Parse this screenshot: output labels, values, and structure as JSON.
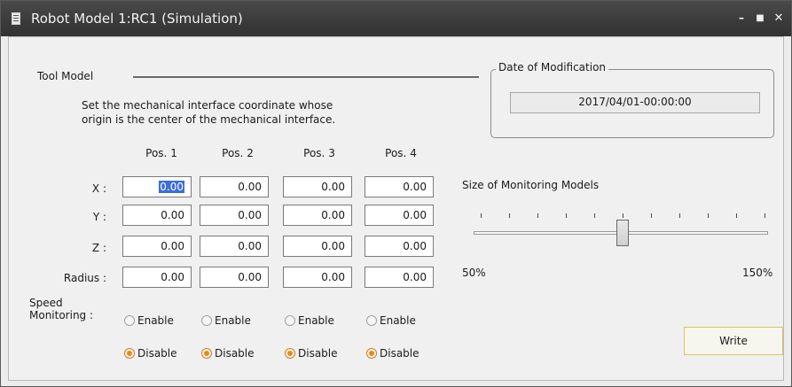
{
  "window": {
    "title": "Robot Model 1:RC1 (Simulation)",
    "minimize_label": "–",
    "maximize_label": "■",
    "close_label": "✕"
  },
  "tool_model": {
    "title": "Tool Model",
    "description_line1": "Set the mechanical interface coordinate whose",
    "description_line2": "origin is the center of the mechanical interface.",
    "columns": [
      "Pos. 1",
      "Pos. 2",
      "Pos. 3",
      "Pos. 4"
    ],
    "rows": [
      {
        "label": "X :",
        "values": [
          "0.00",
          "0.00",
          "0.00",
          "0.00"
        ]
      },
      {
        "label": "Y :",
        "values": [
          "0.00",
          "0.00",
          "0.00",
          "0.00"
        ]
      },
      {
        "label": "Z :",
        "values": [
          "0.00",
          "0.00",
          "0.00",
          "0.00"
        ]
      },
      {
        "label": "Radius :",
        "values": [
          "0.00",
          "0.00",
          "0.00",
          "0.00"
        ]
      }
    ],
    "speed_monitoring_label_line1": "Speed",
    "speed_monitoring_label_line2": "Monitoring :",
    "enable_label": "Enable",
    "disable_label": "Disable",
    "speed_monitoring_selected": [
      "Disable",
      "Disable",
      "Disable",
      "Disable"
    ]
  },
  "date_of_modification": {
    "title": "Date of Modification",
    "value": "2017/04/01-00:00:00"
  },
  "monitoring_size": {
    "title": "Size of Monitoring Models",
    "min_label": "50%",
    "max_label": "150%",
    "value_fraction": 0.5,
    "tick_count": 11
  },
  "actions": {
    "write_label": "Write"
  },
  "colors": {
    "titlebar": "#3a3a3a",
    "selection": "#3a6fd8",
    "radio_checked": "#e08a20",
    "write_border": "#e0c060"
  }
}
